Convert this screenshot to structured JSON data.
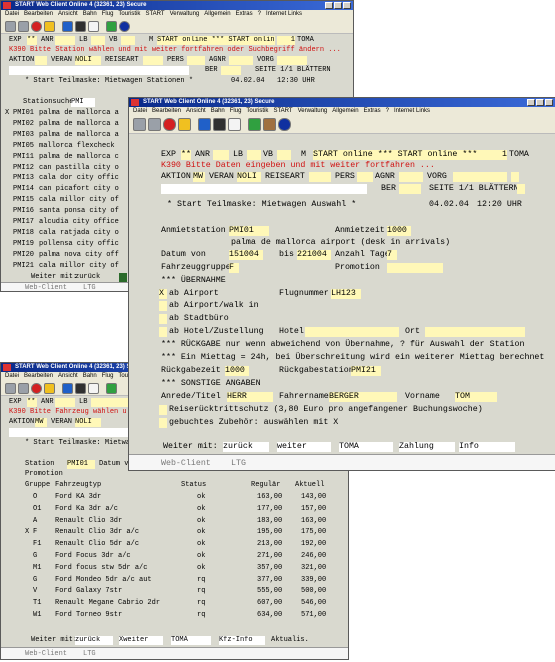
{
  "menu_items": [
    "Datei",
    "Bearbeiten",
    "Ansicht",
    "Bahn",
    "Flug",
    "Touristik",
    "START",
    "Verwaltung",
    "Allgemein",
    "Extras",
    "?",
    "Internet Links"
  ],
  "win1": {
    "title": "START Web Client Online 4 (32361, 23) Secure",
    "exp": "EXP",
    "exp_val": "**",
    "anr": "ANR",
    "lb": "LB",
    "vb": "VB",
    "m": "M",
    "status": "START online *** START online ***",
    "counter": "1",
    "toma": "TOMA",
    "error": "K390 Bitte Station wählen und mit weiter fortfahren oder Suchbegriff ändern ...",
    "aktion": "AKTION",
    "veran": "VERAN",
    "veran_val": "NOLI",
    "reiseart": "REISEART",
    "pers": "PERS",
    "agnr": "AGNR",
    "vorg": "VORG",
    "ber": "BER",
    "seite": "SEITE 1/1 BLÄTTERN",
    "subtitle": "* Start Teilmaske: Mietwagen Stationen *",
    "date": "04.02.04",
    "time": "12:30 UHR",
    "search_label": "Stationsuche",
    "search_val": "PMI",
    "stations": [
      {
        "mark": "X",
        "code": "PMI01",
        "name": "palma de mallorca a"
      },
      {
        "mark": "",
        "code": "PMI02",
        "name": "palma de mallorca a"
      },
      {
        "mark": "",
        "code": "PMI03",
        "name": "palma de mallorca a"
      },
      {
        "mark": "",
        "code": "PMI05",
        "name": "mallorca flexcheck"
      },
      {
        "mark": "",
        "code": "PMI11",
        "name": "palma de mallorca c"
      },
      {
        "mark": "",
        "code": "PMI12",
        "name": "can pastilla city o"
      },
      {
        "mark": "",
        "code": "PMI13",
        "name": "cala dor city offic"
      },
      {
        "mark": "",
        "code": "PMI14",
        "name": "can picafort city o"
      },
      {
        "mark": "",
        "code": "PMI15",
        "name": "cala millor city of"
      },
      {
        "mark": "",
        "code": "PMI16",
        "name": "santa ponsa city of"
      },
      {
        "mark": "",
        "code": "PMI17",
        "name": "alcudia city office"
      },
      {
        "mark": "",
        "code": "PMI18",
        "name": "cala ratjada city o"
      },
      {
        "mark": "",
        "code": "PMI19",
        "name": "pollensa city offic"
      },
      {
        "mark": "",
        "code": "PMI20",
        "name": "palma nova city off"
      },
      {
        "mark": "",
        "code": "PMI21",
        "name": "cala millor city of"
      }
    ],
    "weiter": "Weiter mit:",
    "zurueck": "zurück",
    "webclient": "Web-Client",
    "ltg": "LTG"
  },
  "win2": {
    "title": "START Web Client Online 4 (32361, 23) Secure",
    "exp": "EXP",
    "exp_val": "**",
    "anr": "ANR",
    "lb": "LB",
    "vb": "VB",
    "m": "M",
    "status": "START online *** START online ***",
    "counter": "1",
    "toma": "TOMA",
    "error": "K390 Bitte Daten eingeben und mit weiter fortfahren ...",
    "aktion": "AKTION",
    "aktion_val": "MW",
    "veran": "VERAN",
    "veran_val": "NOLI",
    "reiseart": "REISEART",
    "pers": "PERS",
    "agnr": "AGNR",
    "vorg": "VORG",
    "ber": "BER",
    "seite": "SEITE 1/1 BLÄTTERN",
    "subtitle": "* Start Teilmaske: Mietwagen Auswahl *",
    "date": "04.02.04",
    "time": "12:20 UHR",
    "anmietstation": "Anmietstation",
    "anmietstation_val": "PMI01",
    "anmietzeit": "Anmietzeit",
    "anmietzeit_val": "1000",
    "station_desc": "palma de mallorca airport (desk in arrivals)",
    "datum_von": "Datum von",
    "datum_von_val": "151004",
    "bis": "bis",
    "bis_val": "221004",
    "anzahl_tage": "Anzahl Tage",
    "anzahl_tage_val": "7",
    "fahrzeuggruppe": "Fahrzeuggruppe",
    "fahrzeuggruppe_val": "F",
    "promotion": "Promotion",
    "uebernahme": "*** ÜBERNAHME",
    "opt_airport_mark": "X",
    "opt_airport": "ab Airport",
    "flugnummer": "Flugnummer",
    "flugnummer_val": "LH123",
    "opt_walk": "ab Airport/walk in",
    "opt_stadt": "ab Stadtbüro",
    "opt_hotel": "ab Hotel/Zustellung",
    "hotel": "Hotel",
    "ort": "Ort",
    "rueckgabe_note": "*** RÜCKGABE nur wenn abweichend von Übernahme, ? für Auswahl der Station",
    "mittag_note": "*** Ein Miettag = 24h, bei Überschreitung wird ein weiterer Miettag berechnet",
    "rueckgabezeit": "Rückgabezeit",
    "rueckgabezeit_val": "1000",
    "rueckgabestation": "Rückgabestation",
    "rueckgabestation_val": "PMI21",
    "sonstige": "*** SONSTIGE ANGABEN",
    "anrede": "Anrede/Titel",
    "anrede_val": "HERR",
    "fahrername": "Fahrername",
    "fahrername_val": "BERGER",
    "vorname": "Vorname",
    "vorname_val": "TOM",
    "reiseruecktritt": "Reiserücktrittschutz (3,80 Euro pro angefangener Buchungswoche)",
    "zubehoer": "gebuchtes Zubehör: auswählen mit X",
    "weiter": "Weiter mit:",
    "zurueck": "zurück",
    "weiter2": "weiter",
    "toma2": "TOMA",
    "zahlung": "Zahlung",
    "info": "Info",
    "webclient": "Web-Client",
    "ltg": "LTG"
  },
  "win3": {
    "title": "START Web Client Online 4 (32361, 23) Secure",
    "exp": "EXP",
    "exp_val": "**",
    "anr": "ANR",
    "lb": "LB",
    "error": "K390 Bitte Fahrzeug wählen u",
    "aktion": "AKTION",
    "aktion_val": "MW",
    "veran": "VERAN",
    "veran_val": "NOLI",
    "subtitle": "* Start Teilmaske: Mietwa",
    "station": "Station",
    "station_val": "PMI01",
    "datum_von": "Datum vo",
    "promotion": "Promotion",
    "columns": {
      "gruppe": "Gruppe",
      "typ": "Fahrzeugtyp",
      "status": "Status",
      "regulaer": "Regulär",
      "aktuell": "Aktuell"
    },
    "rows": [
      {
        "mark": "",
        "grp": "O",
        "typ": "Ford KA 3dr",
        "status": "ok",
        "reg": "163,00",
        "akt": "143,00"
      },
      {
        "mark": "",
        "grp": "O1",
        "typ": "Ford Ka 3dr a/c",
        "status": "ok",
        "reg": "177,00",
        "akt": "157,00"
      },
      {
        "mark": "",
        "grp": "A",
        "typ": "Renault Clio 3dr",
        "status": "ok",
        "reg": "183,00",
        "akt": "163,00"
      },
      {
        "mark": "X",
        "grp": "F",
        "typ": "Renault Clio 3dr a/c",
        "status": "ok",
        "reg": "195,00",
        "akt": "175,00"
      },
      {
        "mark": "",
        "grp": "F1",
        "typ": "Renault Clio 5dr a/c",
        "status": "ok",
        "reg": "213,00",
        "akt": "192,00"
      },
      {
        "mark": "",
        "grp": "G",
        "typ": "Ford Focus 3dr a/c",
        "status": "ok",
        "reg": "271,00",
        "akt": "246,00"
      },
      {
        "mark": "",
        "grp": "M1",
        "typ": "Ford focus stw 5dr a/c",
        "status": "ok",
        "reg": "357,00",
        "akt": "321,00"
      },
      {
        "mark": "",
        "grp": "G",
        "typ": "Ford Mondeo 5dr a/c aut",
        "status": "rq",
        "reg": "377,00",
        "akt": "339,00"
      },
      {
        "mark": "",
        "grp": "V",
        "typ": "Ford Galaxy 7str",
        "status": "rq",
        "reg": "555,00",
        "akt": "500,00"
      },
      {
        "mark": "",
        "grp": "T1",
        "typ": "Renault Megane Cabrio 2dr",
        "status": "rq",
        "reg": "607,00",
        "akt": "546,00"
      },
      {
        "mark": "",
        "grp": "W1",
        "typ": "Ford Torneo 9str",
        "status": "rq",
        "reg": "634,00",
        "akt": "571,00"
      }
    ],
    "weiter": "Weiter mit:",
    "zurueck": "zurück",
    "weiter2": "Xweiter",
    "toma2": "TOMA",
    "kfz": "Kfz-Info",
    "aktualis": "Aktualis.",
    "webclient": "Web-Client",
    "ltg": "LTG"
  }
}
